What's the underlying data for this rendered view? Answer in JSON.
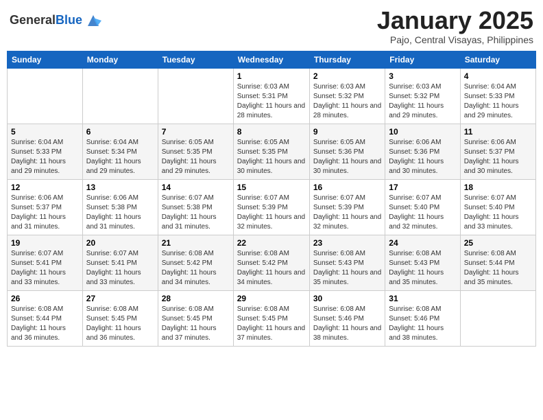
{
  "header": {
    "logo_general": "General",
    "logo_blue": "Blue",
    "month": "January 2025",
    "location": "Pajo, Central Visayas, Philippines"
  },
  "weekdays": [
    "Sunday",
    "Monday",
    "Tuesday",
    "Wednesday",
    "Thursday",
    "Friday",
    "Saturday"
  ],
  "weeks": [
    [
      {
        "day": "",
        "sunrise": "",
        "sunset": "",
        "daylight": ""
      },
      {
        "day": "",
        "sunrise": "",
        "sunset": "",
        "daylight": ""
      },
      {
        "day": "",
        "sunrise": "",
        "sunset": "",
        "daylight": ""
      },
      {
        "day": "1",
        "sunrise": "Sunrise: 6:03 AM",
        "sunset": "Sunset: 5:31 PM",
        "daylight": "Daylight: 11 hours and 28 minutes."
      },
      {
        "day": "2",
        "sunrise": "Sunrise: 6:03 AM",
        "sunset": "Sunset: 5:32 PM",
        "daylight": "Daylight: 11 hours and 28 minutes."
      },
      {
        "day": "3",
        "sunrise": "Sunrise: 6:03 AM",
        "sunset": "Sunset: 5:32 PM",
        "daylight": "Daylight: 11 hours and 29 minutes."
      },
      {
        "day": "4",
        "sunrise": "Sunrise: 6:04 AM",
        "sunset": "Sunset: 5:33 PM",
        "daylight": "Daylight: 11 hours and 29 minutes."
      }
    ],
    [
      {
        "day": "5",
        "sunrise": "Sunrise: 6:04 AM",
        "sunset": "Sunset: 5:33 PM",
        "daylight": "Daylight: 11 hours and 29 minutes."
      },
      {
        "day": "6",
        "sunrise": "Sunrise: 6:04 AM",
        "sunset": "Sunset: 5:34 PM",
        "daylight": "Daylight: 11 hours and 29 minutes."
      },
      {
        "day": "7",
        "sunrise": "Sunrise: 6:05 AM",
        "sunset": "Sunset: 5:35 PM",
        "daylight": "Daylight: 11 hours and 29 minutes."
      },
      {
        "day": "8",
        "sunrise": "Sunrise: 6:05 AM",
        "sunset": "Sunset: 5:35 PM",
        "daylight": "Daylight: 11 hours and 30 minutes."
      },
      {
        "day": "9",
        "sunrise": "Sunrise: 6:05 AM",
        "sunset": "Sunset: 5:36 PM",
        "daylight": "Daylight: 11 hours and 30 minutes."
      },
      {
        "day": "10",
        "sunrise": "Sunrise: 6:06 AM",
        "sunset": "Sunset: 5:36 PM",
        "daylight": "Daylight: 11 hours and 30 minutes."
      },
      {
        "day": "11",
        "sunrise": "Sunrise: 6:06 AM",
        "sunset": "Sunset: 5:37 PM",
        "daylight": "Daylight: 11 hours and 30 minutes."
      }
    ],
    [
      {
        "day": "12",
        "sunrise": "Sunrise: 6:06 AM",
        "sunset": "Sunset: 5:37 PM",
        "daylight": "Daylight: 11 hours and 31 minutes."
      },
      {
        "day": "13",
        "sunrise": "Sunrise: 6:06 AM",
        "sunset": "Sunset: 5:38 PM",
        "daylight": "Daylight: 11 hours and 31 minutes."
      },
      {
        "day": "14",
        "sunrise": "Sunrise: 6:07 AM",
        "sunset": "Sunset: 5:38 PM",
        "daylight": "Daylight: 11 hours and 31 minutes."
      },
      {
        "day": "15",
        "sunrise": "Sunrise: 6:07 AM",
        "sunset": "Sunset: 5:39 PM",
        "daylight": "Daylight: 11 hours and 32 minutes."
      },
      {
        "day": "16",
        "sunrise": "Sunrise: 6:07 AM",
        "sunset": "Sunset: 5:39 PM",
        "daylight": "Daylight: 11 hours and 32 minutes."
      },
      {
        "day": "17",
        "sunrise": "Sunrise: 6:07 AM",
        "sunset": "Sunset: 5:40 PM",
        "daylight": "Daylight: 11 hours and 32 minutes."
      },
      {
        "day": "18",
        "sunrise": "Sunrise: 6:07 AM",
        "sunset": "Sunset: 5:40 PM",
        "daylight": "Daylight: 11 hours and 33 minutes."
      }
    ],
    [
      {
        "day": "19",
        "sunrise": "Sunrise: 6:07 AM",
        "sunset": "Sunset: 5:41 PM",
        "daylight": "Daylight: 11 hours and 33 minutes."
      },
      {
        "day": "20",
        "sunrise": "Sunrise: 6:07 AM",
        "sunset": "Sunset: 5:41 PM",
        "daylight": "Daylight: 11 hours and 33 minutes."
      },
      {
        "day": "21",
        "sunrise": "Sunrise: 6:08 AM",
        "sunset": "Sunset: 5:42 PM",
        "daylight": "Daylight: 11 hours and 34 minutes."
      },
      {
        "day": "22",
        "sunrise": "Sunrise: 6:08 AM",
        "sunset": "Sunset: 5:42 PM",
        "daylight": "Daylight: 11 hours and 34 minutes."
      },
      {
        "day": "23",
        "sunrise": "Sunrise: 6:08 AM",
        "sunset": "Sunset: 5:43 PM",
        "daylight": "Daylight: 11 hours and 35 minutes."
      },
      {
        "day": "24",
        "sunrise": "Sunrise: 6:08 AM",
        "sunset": "Sunset: 5:43 PM",
        "daylight": "Daylight: 11 hours and 35 minutes."
      },
      {
        "day": "25",
        "sunrise": "Sunrise: 6:08 AM",
        "sunset": "Sunset: 5:44 PM",
        "daylight": "Daylight: 11 hours and 35 minutes."
      }
    ],
    [
      {
        "day": "26",
        "sunrise": "Sunrise: 6:08 AM",
        "sunset": "Sunset: 5:44 PM",
        "daylight": "Daylight: 11 hours and 36 minutes."
      },
      {
        "day": "27",
        "sunrise": "Sunrise: 6:08 AM",
        "sunset": "Sunset: 5:45 PM",
        "daylight": "Daylight: 11 hours and 36 minutes."
      },
      {
        "day": "28",
        "sunrise": "Sunrise: 6:08 AM",
        "sunset": "Sunset: 5:45 PM",
        "daylight": "Daylight: 11 hours and 37 minutes."
      },
      {
        "day": "29",
        "sunrise": "Sunrise: 6:08 AM",
        "sunset": "Sunset: 5:45 PM",
        "daylight": "Daylight: 11 hours and 37 minutes."
      },
      {
        "day": "30",
        "sunrise": "Sunrise: 6:08 AM",
        "sunset": "Sunset: 5:46 PM",
        "daylight": "Daylight: 11 hours and 38 minutes."
      },
      {
        "day": "31",
        "sunrise": "Sunrise: 6:08 AM",
        "sunset": "Sunset: 5:46 PM",
        "daylight": "Daylight: 11 hours and 38 minutes."
      },
      {
        "day": "",
        "sunrise": "",
        "sunset": "",
        "daylight": ""
      }
    ]
  ]
}
